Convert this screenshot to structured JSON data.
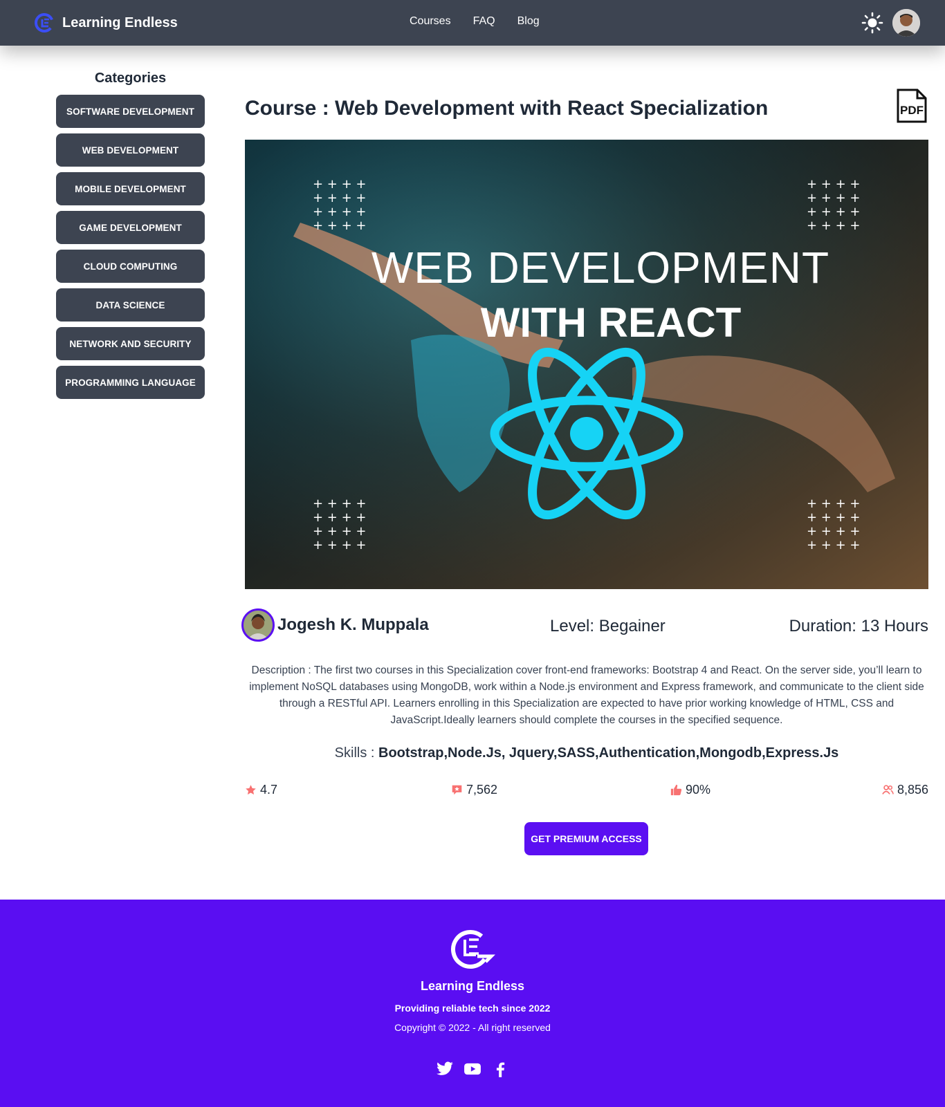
{
  "navbar": {
    "brand_name": "Learning Endless",
    "links": [
      "Courses",
      "FAQ",
      "Blog"
    ],
    "theme_icon": "sun-icon",
    "avatar": "user-avatar"
  },
  "sidebar": {
    "title": "Categories",
    "categories": [
      "SOFTWARE DEVELOPMENT",
      "WEB DEVELOPMENT",
      "MOBILE DEVELOPMENT",
      "GAME DEVELOPMENT",
      "CLOUD COMPUTING",
      "DATA SCIENCE",
      "NETWORK AND SECURITY",
      "PROGRAMMING LANGUAGE"
    ]
  },
  "course": {
    "title": "Course : Web Development with React Specialization",
    "pdf_icon": "pdf-icon",
    "hero_line1": "WEB DEVELOPMENT",
    "hero_line2": "WITH REACT",
    "instructor": "Jogesh K. Muppala",
    "level": "Level: Begainer",
    "duration": "Duration: 13 Hours",
    "description": "Description : The first two courses in this Specialization cover front-end frameworks: Bootstrap 4 and React. On the server side, you’ll learn to implement NoSQL databases using MongoDB, work within a Node.js environment and Express framework, and communicate to the client side through a RESTful API. Learners enrolling in this Specialization are expected to have prior working knowledge of HTML, CSS and JavaScript.Ideally learners should complete the courses in the specified sequence.",
    "skills_label": "Skills : ",
    "skills_value": "Bootstrap,Node.Js, Jquery,SASS,Authentication,Mongodb,Express.Js",
    "stats": {
      "rating": "4.7",
      "reviews": "7,562",
      "like_percent": "90%",
      "students": "8,856"
    },
    "cta_label": "GET PREMIUM ACCESS"
  },
  "footer": {
    "name": "Learning Endless",
    "tagline": "Providing reliable tech since 2022",
    "copyright": "Copyright © 2022 - All right reserved",
    "social_icons": [
      "twitter-icon",
      "youtube-icon",
      "facebook-icon"
    ]
  },
  "colors": {
    "navbar_bg": "#3d4451",
    "accent": "#5b0ff2",
    "footer_bg": "#5a0ef2",
    "stat_icon": "#f87171",
    "react_cyan": "#16d3f5"
  }
}
